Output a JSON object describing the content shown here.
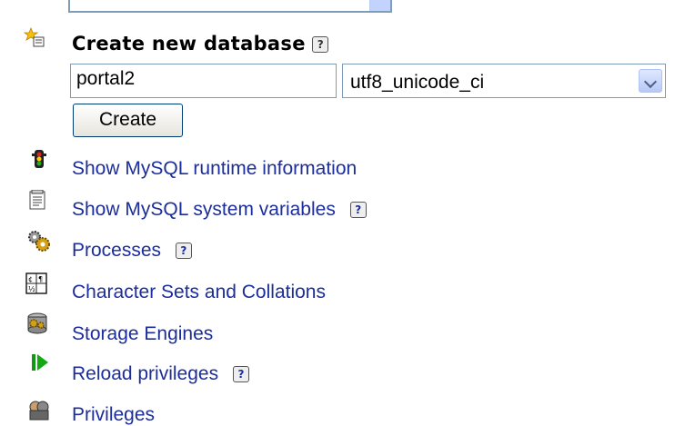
{
  "create_db": {
    "title": "Create new database",
    "help": "?",
    "name_value": "portal2",
    "collation_value": "utf8_unicode_ci",
    "create_label": "Create"
  },
  "links": [
    {
      "label": "Show MySQL runtime information",
      "icon": "traffic-light-icon",
      "help": ""
    },
    {
      "label": "Show MySQL system variables",
      "icon": "variables-icon",
      "help": "?"
    },
    {
      "label": "Processes",
      "icon": "processes-icon",
      "help": "?"
    },
    {
      "label": "Character Sets and Collations",
      "icon": "charset-icon",
      "help": ""
    },
    {
      "label": "Storage Engines",
      "icon": "storage-engines-icon",
      "help": ""
    },
    {
      "label": "Reload privileges",
      "icon": "reload-icon",
      "help": "?"
    },
    {
      "label": "Privileges",
      "icon": "privileges-icon",
      "help": ""
    }
  ],
  "colors": {
    "link": "#1c2d9c",
    "border": "#7f9db9"
  }
}
